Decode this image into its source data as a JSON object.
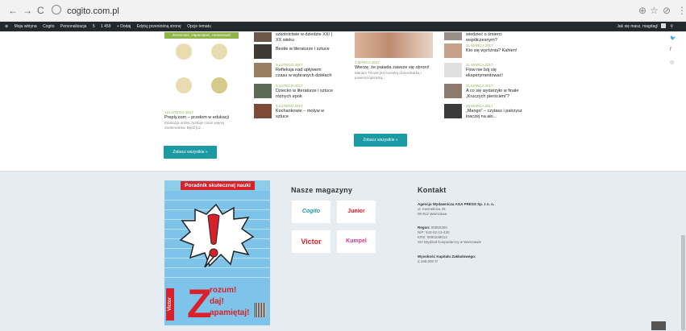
{
  "browser": {
    "back": "←",
    "forward": "→",
    "reload": "C",
    "url": "cogito.com.pl",
    "zoom": "⊕",
    "star": "☆",
    "ext": "⊘",
    "menu": "⋮"
  },
  "wpbar": {
    "items": [
      "Moja witryna",
      "Cogito",
      "Personalizacja",
      "5",
      "1 459",
      "+ Dodaj",
      "Edytuj przeniośną stronę",
      "Opcje tematu"
    ],
    "right": "Jak się masz, magdag!"
  },
  "articles": {
    "col1": {
      "image_caption": "Zrozumieć, zapamiętać, zastosować",
      "date": "13 LUTEGO 2017",
      "title": "Preply.com – przełom w edukacji",
      "excerpt": "Edukacja online zyskuje coraz więcej zwolenników. Będź już..."
    },
    "col2": [
      {
        "date": "",
        "title": "szkolnictwie w dziedzie XXI | XX wieku"
      },
      {
        "date": "",
        "title": "Bestie w literaturze i sztuce"
      },
      {
        "date": "9 LUTEGO 2017",
        "title": "Refleksja nad upływem czasu w wybranych dziełach"
      },
      {
        "date": "9 LUTEGO 2017",
        "title": "Dziecko w literaturze i sztuce różnych epok"
      },
      {
        "date": "9 LUTEGO 2017",
        "title": "Kochankowie – motyw w sztuce"
      }
    ],
    "col3": {
      "date": "3 MARCA 2017",
      "title": "Wierzę, że prawda zawsze się obroni!",
      "excerpt": "Mariam Trimas jest tureską dziennikarką i powieściopisarką..."
    },
    "col4": [
      {
        "date": "",
        "title": "wiedzieć o śmierci współczesnym?"
      },
      {
        "date": "21 MARCA 2017",
        "title": "Kto się wyróżnia? Kahlen!"
      },
      {
        "date": "21 MARCA 2017",
        "title": "Flow nie bój się eksperymentować!"
      },
      {
        "date": "21 MARCA 2017",
        "title": "A co się wydarzyło w finale „Kruczych pierścieni”?"
      },
      {
        "date": "20 MARCA 2017",
        "title": "„Mango” – czytasz i patrzysz inaczej na ało..."
      }
    ],
    "more_btn": "Zobacz wszystkie »"
  },
  "footer": {
    "cover": {
      "header": "Poradnik skutecznej nauki",
      "brand": "Victor",
      "big": "Z",
      "lines": [
        "rozum!",
        "daj!",
        "apamiętaj!"
      ]
    },
    "magazines_title": "Nasze magazyny",
    "magazines": [
      "Cogito",
      "Junior",
      "Victor",
      "Kumpel"
    ],
    "contact_title": "Kontakt",
    "contact": {
      "company": "Agencja Wydawnicza AGA PRESS Sp. z o. o.",
      "street": "ul. Karmelicka 45",
      "city": "00-812 Warszawa",
      "regon_label": "Regon:",
      "regon": "00050300",
      "nip": "NIP: 542-02-13-430",
      "krs": "KRS: 0000248014",
      "court": "XIII Wydział Gospodarczy w Warszawie",
      "capital_label": "Wysokość Kapitału Zakładowego:",
      "capital": "2.188.000 zł"
    }
  },
  "colors": {
    "accent": "#1b9aa4",
    "date_green": "#8fb54a",
    "cover_red": "#d8212a",
    "cover_blue": "#7ec4ea"
  }
}
